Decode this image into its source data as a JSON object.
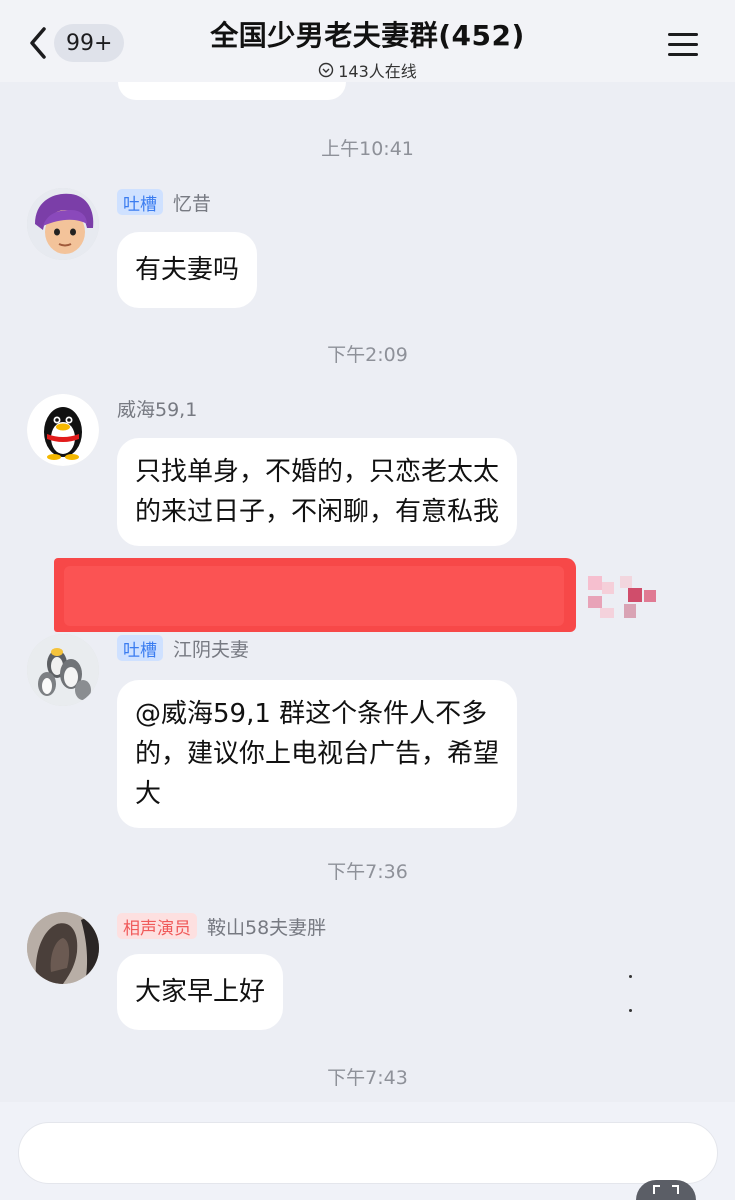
{
  "header": {
    "back_badge": "99+",
    "title": "全国少男老夫妻群(452)",
    "online_count": "143人在线"
  },
  "messages": [
    {
      "timestamp": "上午10:41",
      "badge": "吐槽",
      "badge_color": "#3a7cf0",
      "nickname": "忆昔",
      "text": "有夫妻吗",
      "avatar": "cartoon-avatar"
    },
    {
      "timestamp": "下午2:09",
      "nickname": "威海59,1",
      "line1": "只找单身，不婚的，只恋老太太",
      "line2": "的来过日子，不闲聊，有意私我",
      "avatar": "penguin-avatar"
    },
    {
      "badge": "吐槽",
      "badge_color": "#3a7cf0",
      "nickname": "江阴夫妻",
      "line1": "@威海59,1 群这个条件人不多",
      "line2": "的，建议你上电视台广告，希望",
      "line3": "大",
      "avatar": "penguins-avatar"
    },
    {
      "timestamp": "下午7:36",
      "badge": "相声演员",
      "badge_color": "#f05a5a",
      "nickname": "鞍山58夫妻胖",
      "text": "大家早上好",
      "avatar": "photo-avatar"
    },
    {
      "timestamp": "下午7:43"
    }
  ],
  "colors": {
    "background": "#eceef4",
    "bubble": "#ffffff",
    "redaction": "#f74848"
  }
}
